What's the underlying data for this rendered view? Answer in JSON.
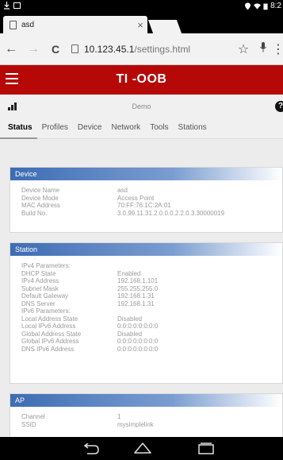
{
  "statusbar": {
    "time": "8:2"
  },
  "tab": {
    "title": "asd",
    "close": "×"
  },
  "omnibar": {
    "host": "10.123.45.1",
    "path": "/settings.html",
    "back": "←",
    "forward": "→",
    "reload": "C",
    "star": "☆",
    "mic": "🎤",
    "menu": "⋮"
  },
  "app": {
    "title": "TI -OOB"
  },
  "subheader": {
    "device_name": "Demo",
    "help": "?"
  },
  "nav": {
    "tabs": [
      {
        "label": "Status"
      },
      {
        "label": "Profiles"
      },
      {
        "label": "Device"
      },
      {
        "label": "Network"
      },
      {
        "label": "Tools"
      },
      {
        "label": "Stations"
      }
    ]
  },
  "device": {
    "title": "Device",
    "rows": [
      {
        "k": "Device Name",
        "v": "asd"
      },
      {
        "k": "Device Mode",
        "v": "Access Point"
      },
      {
        "k": "MAC Address",
        "v": "70:FF:76:1C:2A:01"
      },
      {
        "k": "Build No.",
        "v": "3.0.99.11.31.2.0.0.0.2.2.0.3.30000019"
      }
    ]
  },
  "station": {
    "title": "Station",
    "rows": [
      {
        "k": "IPv4 Parameters:",
        "v": ""
      },
      {
        "k": "DHCP State",
        "v": "Enabled"
      },
      {
        "k": "IPv4 Address",
        "v": "192.168.1.101"
      },
      {
        "k": "Subnet Mask",
        "v": "255.255.255.0"
      },
      {
        "k": "Default Gateway",
        "v": "192.168.1.31"
      },
      {
        "k": "DNS Server",
        "v": "192.168.1.31"
      },
      {
        "k": "IPv6 Parameters:",
        "v": ""
      },
      {
        "k": "Local Address State",
        "v": "Disabled"
      },
      {
        "k": "Local IPv6 Address",
        "v": "0:0:0:0:0:0:0:0"
      },
      {
        "k": "Global Address State",
        "v": "Disabled"
      },
      {
        "k": "Global IPv6 Address",
        "v": "0:0:0:0:0:0:0:0"
      },
      {
        "k": "DNS IPv6 Address",
        "v": "0:0:0:0:0:0:0:0"
      }
    ]
  },
  "ap": {
    "title": "AP",
    "rows": [
      {
        "k": "Channel",
        "v": "1"
      },
      {
        "k": "SSID",
        "v": "mysimplelink"
      }
    ]
  }
}
